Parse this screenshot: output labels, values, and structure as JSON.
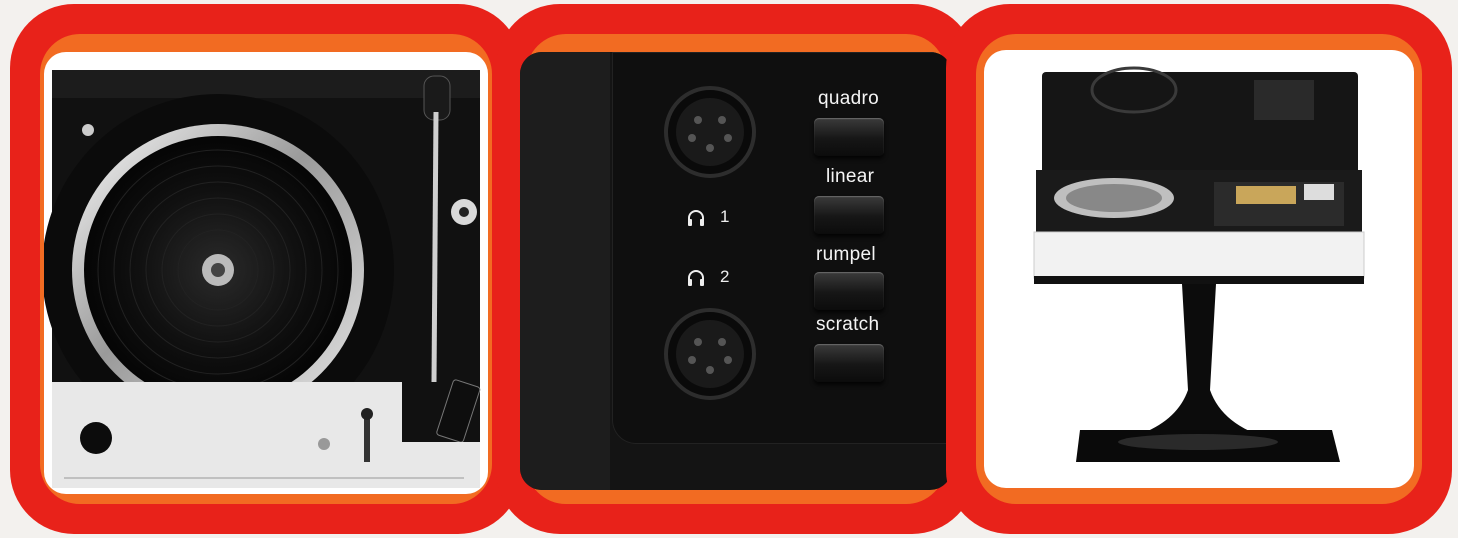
{
  "colors": {
    "outer_red": "#e8221a",
    "inner_orange": "#f26b22",
    "panel_black": "#151515",
    "white": "#ffffff"
  },
  "panels": [
    {
      "name": "turntable-panel"
    },
    {
      "name": "control-buttons-panel",
      "buttons": [
        "quadro",
        "linear",
        "rumpel",
        "scratch"
      ],
      "headphones": [
        {
          "icon": "headphones-icon",
          "label": "1"
        },
        {
          "icon": "headphones-icon",
          "label": "2"
        }
      ]
    },
    {
      "name": "console-stand-panel"
    }
  ]
}
